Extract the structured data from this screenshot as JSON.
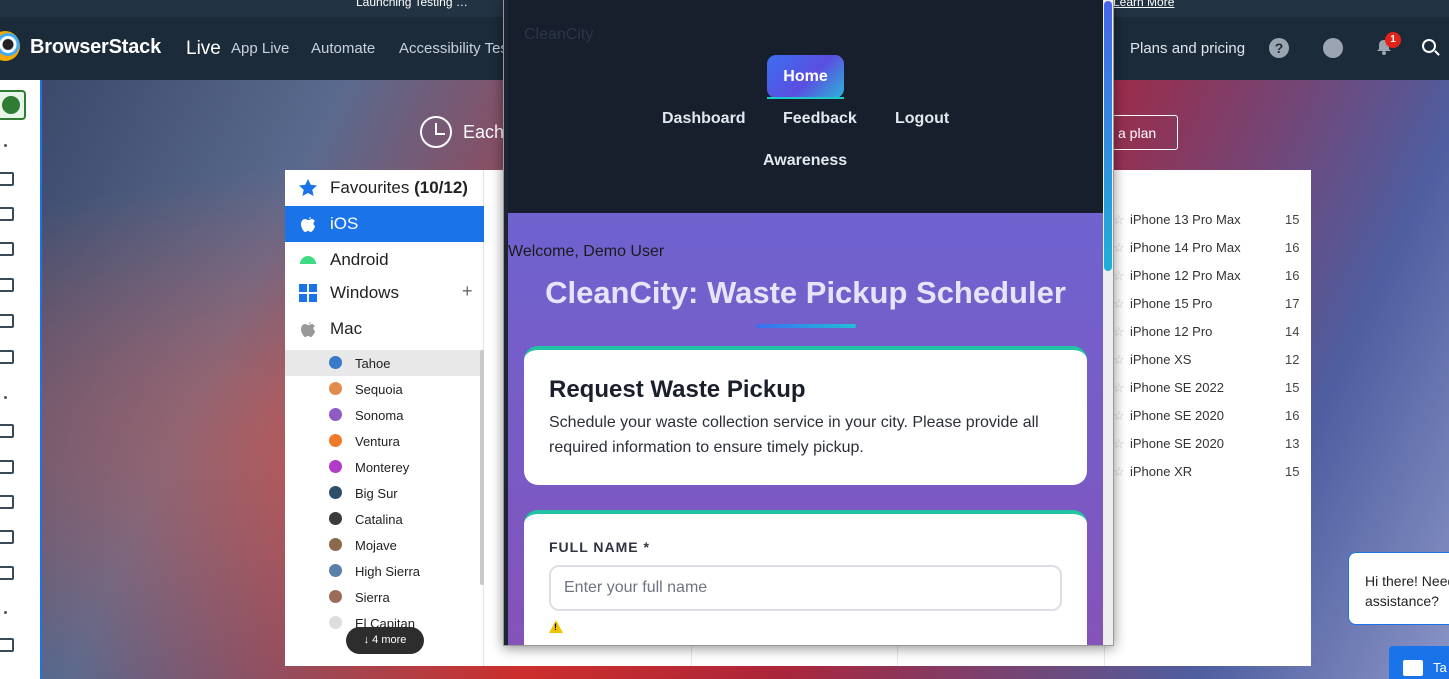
{
  "banner": {
    "text": "Launching Testing …",
    "link": "Learn More"
  },
  "topnav": {
    "brand": "BrowserStack",
    "product": "Live",
    "links": [
      "App Live",
      "Automate",
      "Accessibility Tes"
    ],
    "plans": "Plans and pricing",
    "notification_count": "1"
  },
  "hero": {
    "each_text": "Each",
    "plan_button": "a plan"
  },
  "os_list": {
    "favourites_label": "Favourites",
    "favourites_count": "(10/12)",
    "items": [
      "iOS",
      "Android",
      "Windows",
      "Mac"
    ],
    "mac_versions": [
      "Tahoe",
      "Sequoia",
      "Sonoma",
      "Ventura",
      "Monterey",
      "Big Sur",
      "Catalina",
      "Mojave",
      "High Sierra",
      "Sierra",
      "El Capitan"
    ],
    "more_button": "4 more"
  },
  "devices": [
    {
      "name": "iPhone 13 Pro Max",
      "version": "15"
    },
    {
      "name": "iPhone 14 Pro Max",
      "version": "16"
    },
    {
      "name": "iPhone 12 Pro Max",
      "version": "16"
    },
    {
      "name": "iPhone 15 Pro",
      "version": "17"
    },
    {
      "name": "iPhone 12 Pro",
      "version": "14"
    },
    {
      "name": "iPhone XS",
      "version": "12"
    },
    {
      "name": "iPhone SE 2022",
      "version": "15"
    },
    {
      "name": "iPhone SE 2020",
      "version": "16"
    },
    {
      "name": "iPhone SE 2020",
      "version": "13"
    },
    {
      "name": "iPhone XR",
      "version": "15"
    }
  ],
  "app": {
    "brand": "CleanCity",
    "nav": {
      "home": "Home",
      "dashboard": "Dashboard",
      "feedback": "Feedback",
      "logout": "Logout",
      "awareness": "Awareness"
    },
    "welcome": "Welcome, Demo User",
    "title": "CleanCity: Waste Pickup Scheduler",
    "card": {
      "title": "Request Waste Pickup",
      "description": "Schedule your waste collection service in your city. Please provide all required information to ensure timely pickup."
    },
    "form": {
      "full_name_label": "FULL NAME *",
      "full_name_placeholder": "Enter your full name",
      "full_name_value": ""
    }
  },
  "chat": {
    "bubble": "Hi there! Need assistance?",
    "button": "Ta"
  },
  "colors": {
    "accent": "#1a73e8",
    "app_gradient_start": "#6f63cf",
    "app_header": "#171f2c"
  }
}
